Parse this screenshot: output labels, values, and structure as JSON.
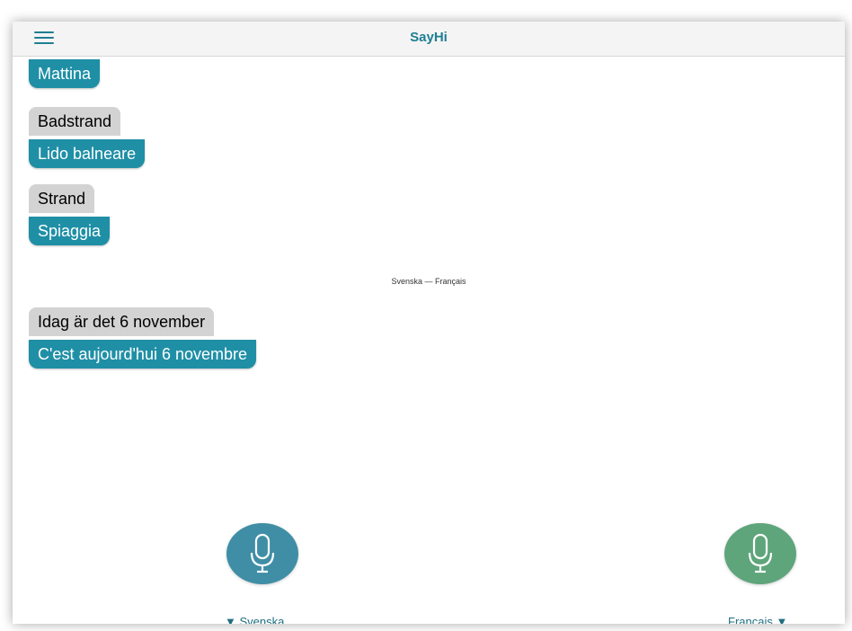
{
  "app": {
    "title": "SayHi"
  },
  "conversation": [
    {
      "translation": "Mattina"
    },
    {
      "source": "Badstrand",
      "translation": "Lido balneare"
    },
    {
      "source": "Strand",
      "translation": "Spiaggia"
    },
    {
      "source": "Idag är det 6 november",
      "translation": "C'est aujourd'hui 6 novembre"
    }
  ],
  "pair_label": "Svenska — Français",
  "languages": {
    "left": {
      "label": "▼ Svenska",
      "color": "#3f8ea6"
    },
    "right": {
      "label": "Français ▼",
      "color": "#5fa57b"
    }
  },
  "colors": {
    "accent": "#1f7e93",
    "translation_bubble": "#1f8fa6",
    "source_bubble": "#d3d3d3"
  },
  "icons": {
    "menu": "hamburger-menu-icon",
    "mic": "microphone-icon"
  }
}
